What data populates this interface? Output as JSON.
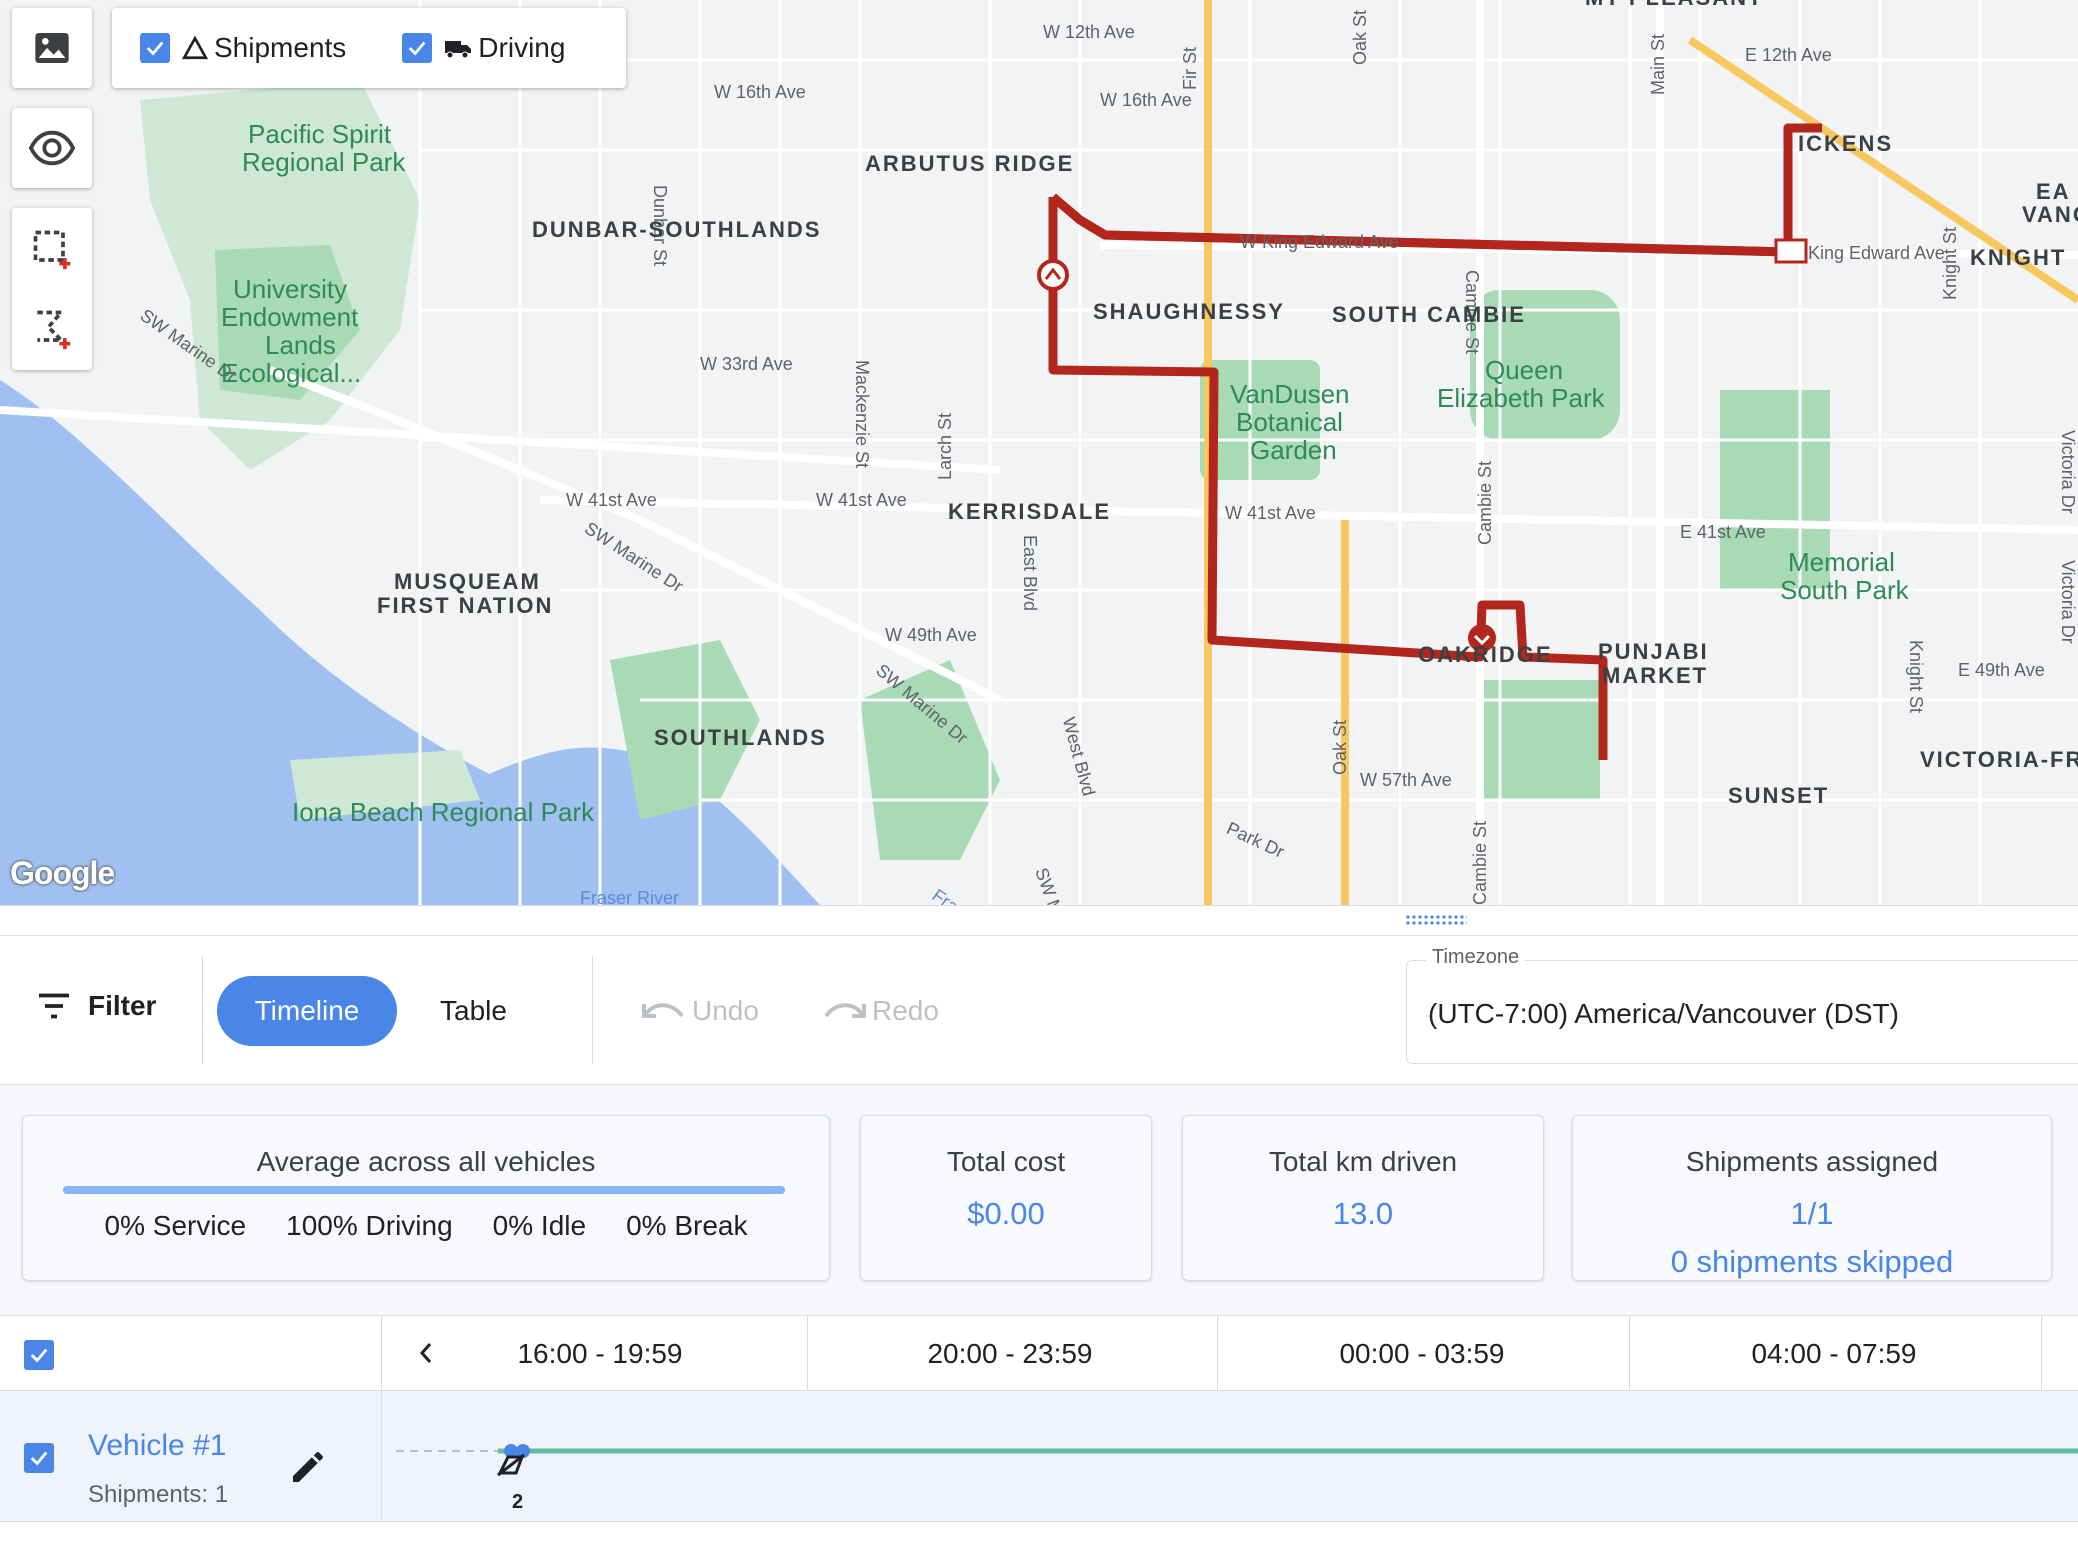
{
  "map": {
    "streets": [
      "W 12th Ave",
      "E 12th Ave",
      "W 16th Ave",
      "W 16th Ave",
      "Dunbar St",
      "Fir St",
      "Oak St",
      "Main St",
      "W King Edward Ave",
      "King Edward Ave",
      "Knight St",
      "Cambie St",
      "W 33rd Ave",
      "Mackenzie St",
      "Larch St",
      "W 41st Ave",
      "W 41st Ave",
      "W 41st Ave",
      "E 41st Ave",
      "SW Marine Dr",
      "SW Marine Dr",
      "SW Marine Dr",
      "East Blvd",
      "W 49th Ave",
      "West Blvd",
      "Cambie St",
      "Oak St",
      "W 57th Ave",
      "Park Dr",
      "Cambie St",
      "E 49th Ave",
      "Knight St",
      "Victoria Dr",
      "Victoria Dr",
      "Fraser River",
      "SW M",
      "Fra"
    ],
    "neighborhoods": [
      "MT PLEASANT",
      "ARBUTUS RIDGE",
      "DUNBAR-SOUTHLANDS",
      "SHAUGHNESSY",
      "SOUTH CAMBIE",
      "KERRISDALE",
      "MUSQUEAM",
      "FIRST NATION",
      "SOUTHLANDS",
      "OAKRIDGE",
      "PUNJABI",
      "MARKET",
      "SUNSET",
      "VICTORIA-FR",
      "KNIGHT",
      "EA",
      "VANC",
      "ICKENS"
    ],
    "parks": [
      "Pacific Spirit",
      "Regional Park",
      "University",
      "Endowment",
      "Lands",
      "Ecological...",
      "VanDusen",
      "Botanical",
      "Garden",
      "Queen",
      "Elizabeth Park",
      "Memorial",
      "South Park",
      "Iona Beach Regional Park"
    ],
    "logo": "Google",
    "route_color": "#b3261e"
  },
  "controls": {
    "image_icon": "image-icon",
    "visibility_icon": "eye-icon",
    "select_rect_icon": "select-rectangle-icon",
    "select_poly_icon": "select-polygon-icon",
    "layers": [
      {
        "label": "Shipments",
        "icon": "triangle-icon",
        "checked": true
      },
      {
        "label": "Driving",
        "icon": "truck-icon",
        "checked": true
      }
    ]
  },
  "toolbar": {
    "filter_label": "Filter",
    "timeline_label": "Timeline",
    "table_label": "Table",
    "undo_label": "Undo",
    "redo_label": "Redo",
    "timezone_label": "Timezone",
    "timezone_value": "(UTC-7:00) America/Vancouver (DST)"
  },
  "stats": {
    "average": {
      "title": "Average across all vehicles",
      "driving_fraction": 1.0,
      "service": "0% Service",
      "driving": "100% Driving",
      "idle": "0% Idle",
      "break": "0% Break"
    },
    "total_cost": {
      "title": "Total cost",
      "value": "$0.00"
    },
    "total_km": {
      "title": "Total km driven",
      "value": "13.0"
    },
    "shipments": {
      "title": "Shipments assigned",
      "value": "1/1",
      "skipped": "0 shipments skipped"
    }
  },
  "timeline": {
    "slots": [
      "16:00 - 19:59",
      "20:00 - 23:59",
      "00:00 - 03:59",
      "04:00 - 07:59"
    ],
    "vehicles": [
      {
        "name": "Vehicle #1",
        "shipments": "Shipments: 1",
        "stop_count": "2"
      }
    ],
    "accent": "#4a86e8",
    "route_line_color": "#5fbf9f"
  }
}
